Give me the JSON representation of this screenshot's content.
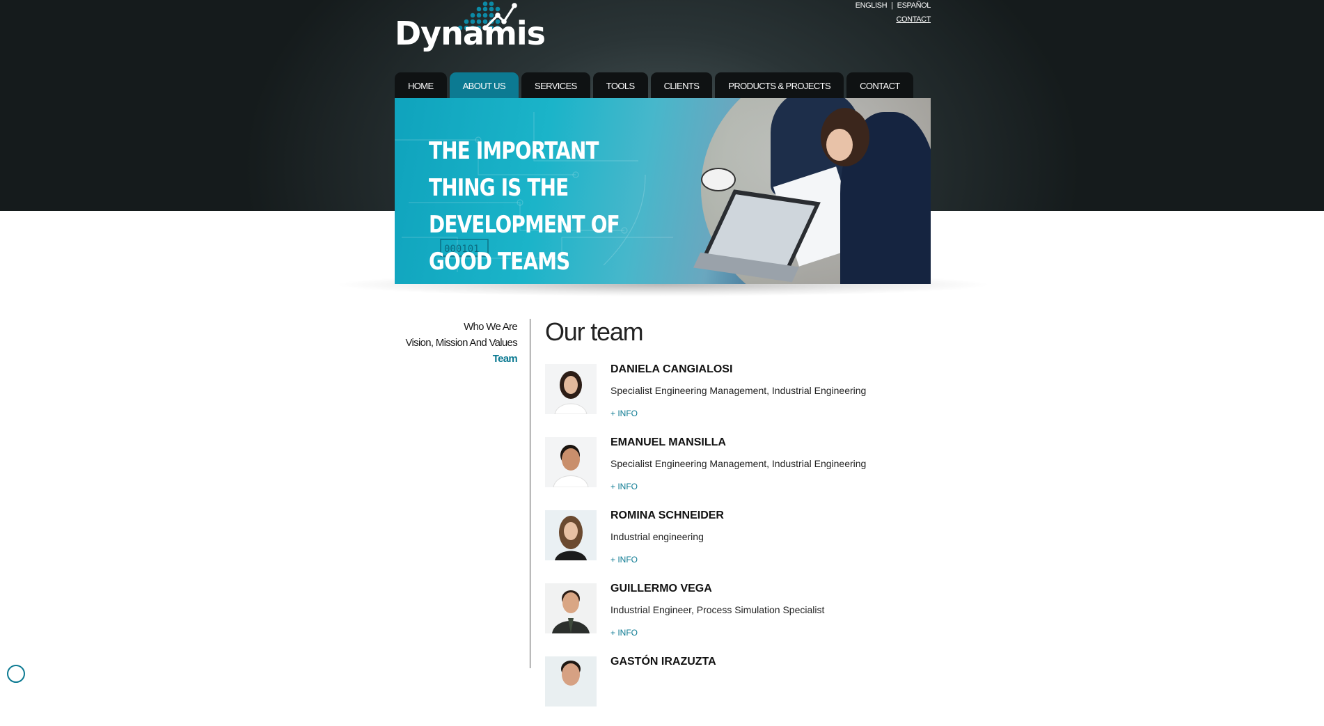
{
  "brand": {
    "logo_text": "Dynamis",
    "accent": "#0c7a92",
    "header_bg": "#1e2729",
    "tab_bg": "#0f1213"
  },
  "lang": {
    "english": "ENGLISH",
    "espanol": "ESPAÑOL",
    "contact": "CONTACT"
  },
  "nav": {
    "items": [
      {
        "label": "HOME"
      },
      {
        "label": "ABOUT US",
        "active": true
      },
      {
        "label": "SERVICES"
      },
      {
        "label": "TOOLS"
      },
      {
        "label": "CLIENTS"
      },
      {
        "label": "PRODUCTS & PROJECTS"
      },
      {
        "label": "CONTACT"
      }
    ]
  },
  "hero": {
    "title": "THE IMPORTANT THING IS THE DEVELOPMENT OF GOOD TEAMS",
    "circuit_label": "000101"
  },
  "sidebar": {
    "items": [
      {
        "label": "Who We Are"
      },
      {
        "label": "Vision, Mission And Values"
      },
      {
        "label": "Team",
        "active": true
      }
    ]
  },
  "main": {
    "title": "Our team",
    "members": [
      {
        "name": "DANIELA CANGIALOSI",
        "role": "Specialist Engineering Management, Industrial Engineering",
        "info": "+ INFO"
      },
      {
        "name": "EMANUEL MANSILLA",
        "role": "Specialist Engineering Management, Industrial Engineering",
        "info": "+ INFO"
      },
      {
        "name": "ROMINA SCHNEIDER",
        "role": "Industrial engineering",
        "info": "+ INFO"
      },
      {
        "name": "GUILLERMO VEGA",
        "role": "Industrial Engineer, Process Simulation Specialist",
        "info": "+ INFO"
      },
      {
        "name": "GASTÓN IRAZUZTA",
        "role": "",
        "info": ""
      }
    ]
  }
}
